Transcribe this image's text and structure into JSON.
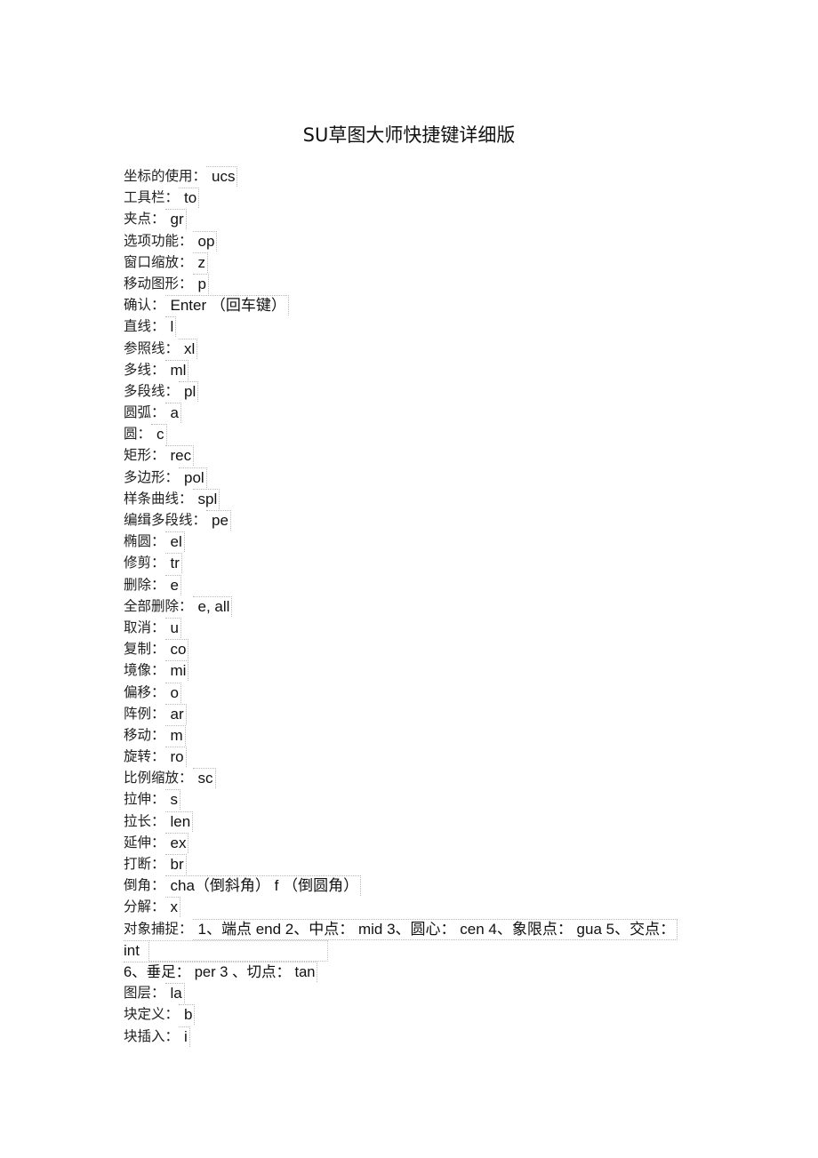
{
  "document": {
    "title": "SU草图大师快捷键详细版",
    "shortcuts": [
      {
        "label": "坐标的使用：",
        "key": "ucs"
      },
      {
        "label": "工具栏：",
        "key": "to"
      },
      {
        "label": "夹点：",
        "key": "gr"
      },
      {
        "label": "选项功能：",
        "key": "op"
      },
      {
        "label": "窗口缩放：",
        "key": "z"
      },
      {
        "label": "移动图形：",
        "key": "p"
      },
      {
        "label": "确认：",
        "key": "Enter （回车键）"
      },
      {
        "label": "直线：",
        "key": "l"
      },
      {
        "label": "参照线：",
        "key": "xl"
      },
      {
        "label": "多线：",
        "key": "ml"
      },
      {
        "label": "多段线：",
        "key": "pl"
      },
      {
        "label": "圆弧：",
        "key": "a"
      },
      {
        "label": "圆：",
        "key": "c"
      },
      {
        "label": "矩形：",
        "key": "rec"
      },
      {
        "label": "多边形：",
        "key": "pol"
      },
      {
        "label": "样条曲线：",
        "key": "spl"
      },
      {
        "label": "编缉多段线：",
        "key": "pe"
      },
      {
        "label": "椭圆：",
        "key": "el"
      },
      {
        "label": "修剪：",
        "key": "tr"
      },
      {
        "label": "删除：",
        "key": "e"
      },
      {
        "label": "全部删除：",
        "key": "e, all"
      },
      {
        "label": "取消：",
        "key": "u"
      },
      {
        "label": "复制：",
        "key": "co"
      },
      {
        "label": "境像：",
        "key": "mi"
      },
      {
        "label": "偏移：",
        "key": "o"
      },
      {
        "label": "阵例：",
        "key": "ar"
      },
      {
        "label": "移动：",
        "key": "m"
      },
      {
        "label": "旋转：",
        "key": "ro"
      },
      {
        "label": "比例缩放：",
        "key": "sc"
      },
      {
        "label": "拉伸：",
        "key": "s"
      },
      {
        "label": "拉长：",
        "key": "len"
      },
      {
        "label": "延伸：",
        "key": "ex"
      },
      {
        "label": "打断：",
        "key": "br"
      },
      {
        "label": "倒角：",
        "key": "cha（倒斜角） f （倒圆角）"
      },
      {
        "label": "分解：",
        "key": "x"
      }
    ],
    "object_snap": {
      "label": "对象捕捉：",
      "line1": "1、端点 end 2、中点： mid 3、圆心： cen 4、象限点： gua 5、交点：",
      "line2": "int",
      "line3": "6、垂足： per 3 、切点： tan"
    },
    "shortcuts_after": [
      {
        "label": "图层：",
        "key": "la"
      },
      {
        "label": "块定义：",
        "key": "b"
      },
      {
        "label": "块插入：",
        "key": "i"
      }
    ]
  }
}
